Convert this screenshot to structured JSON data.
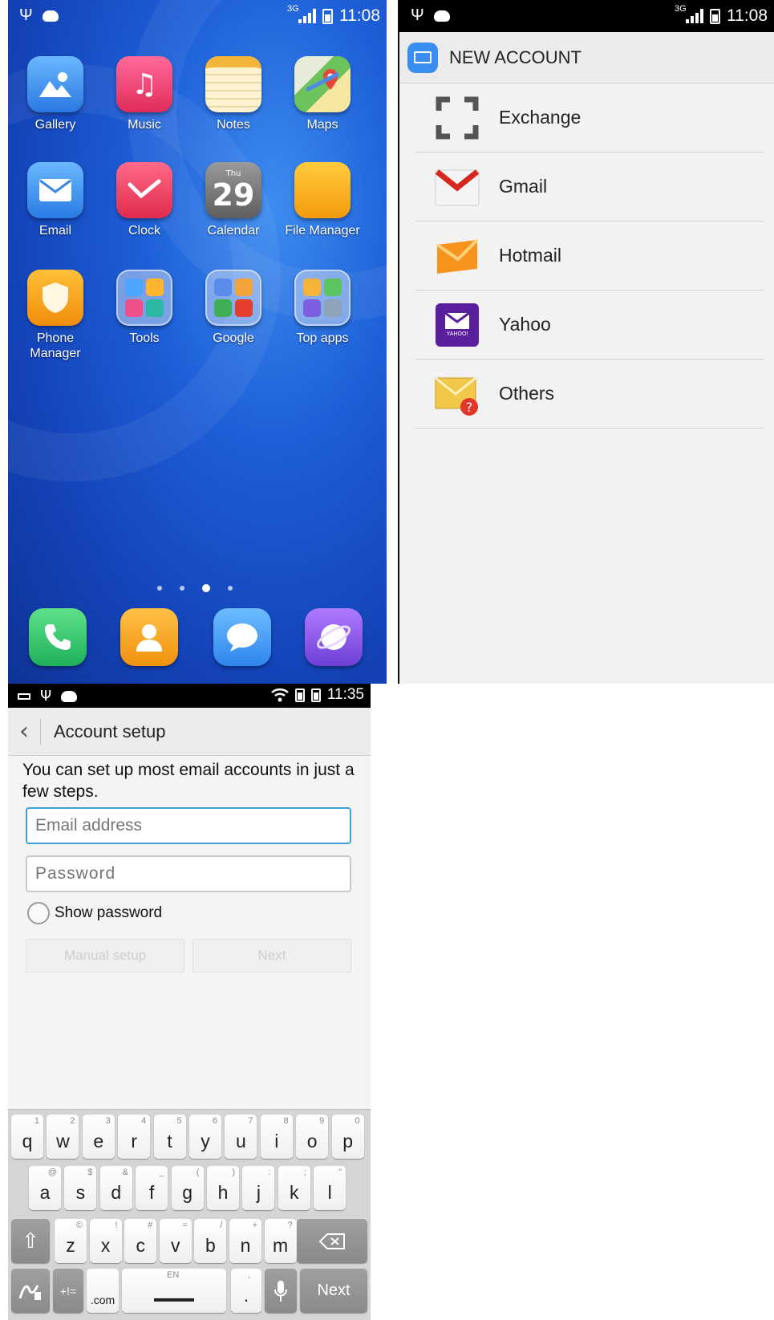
{
  "home": {
    "status": {
      "time": "11:08",
      "network": "3G"
    },
    "apps": [
      {
        "label": "Gallery",
        "icon": "gallery-icon"
      },
      {
        "label": "Music",
        "icon": "music-icon"
      },
      {
        "label": "Notes",
        "icon": "notes-icon"
      },
      {
        "label": "Maps",
        "icon": "maps-icon"
      },
      {
        "label": "Email",
        "icon": "email-icon"
      },
      {
        "label": "Clock",
        "icon": "clock-icon"
      },
      {
        "label": "Calendar",
        "icon": "calendar-icon",
        "day_name": "Thu",
        "day_number": "29"
      },
      {
        "label": "File Manager",
        "icon": "file-manager-icon"
      },
      {
        "label": "Phone Manager",
        "icon": "phone-manager-icon"
      },
      {
        "label": "Tools",
        "icon": "tools-folder-icon"
      },
      {
        "label": "Google",
        "icon": "google-folder-icon"
      },
      {
        "label": "Top apps",
        "icon": "top-apps-folder-icon"
      }
    ],
    "dock": [
      "phone-icon",
      "contacts-icon",
      "messages-icon",
      "browser-icon"
    ],
    "page_indicator": {
      "pages": 4,
      "current": 3
    }
  },
  "new_account": {
    "status": {
      "time": "11:08",
      "network": "3G"
    },
    "title": "NEW ACCOUNT",
    "options": [
      {
        "label": "Exchange",
        "icon": "exchange-icon"
      },
      {
        "label": "Gmail",
        "icon": "gmail-icon"
      },
      {
        "label": "Hotmail",
        "icon": "hotmail-icon"
      },
      {
        "label": "Yahoo",
        "icon": "yahoo-icon",
        "badge": "YAHOO!"
      },
      {
        "label": "Others",
        "icon": "others-mail-icon"
      }
    ]
  },
  "setup": {
    "status": {
      "time": "11:35"
    },
    "title": "Account setup",
    "intro": "You can set up most email accounts in just a few steps.",
    "email_placeholder": "Email address",
    "password_placeholder": "Password",
    "show_password": "Show password",
    "manual_setup": "Manual setup",
    "next": "Next",
    "keyboard": {
      "row1": [
        [
          "q",
          "1"
        ],
        [
          "w",
          "2"
        ],
        [
          "e",
          "3"
        ],
        [
          "r",
          "4"
        ],
        [
          "t",
          "5"
        ],
        [
          "y",
          "6"
        ],
        [
          "u",
          "7"
        ],
        [
          "i",
          "8"
        ],
        [
          "o",
          "9"
        ],
        [
          "p",
          "0"
        ]
      ],
      "row2": [
        [
          "a",
          "@"
        ],
        [
          "s",
          "$"
        ],
        [
          "d",
          "&"
        ],
        [
          "f",
          "_"
        ],
        [
          "g",
          "("
        ],
        [
          "h",
          ")"
        ],
        [
          "j",
          ":"
        ],
        [
          "k",
          ";"
        ],
        [
          "l",
          "\""
        ]
      ],
      "row3": [
        [
          "z",
          "©"
        ],
        [
          "x",
          "!"
        ],
        [
          "c",
          "#"
        ],
        [
          "v",
          "="
        ],
        [
          "b",
          "/"
        ],
        [
          "n",
          "+"
        ],
        [
          "m",
          "?"
        ]
      ],
      "symbols_key": "+!=",
      "com_key": ".com",
      "space_lang": "EN",
      "period_key": ".",
      "period_hint": ",",
      "action_key": "Next"
    },
    "colors": {
      "focus_border": "#3da0d6"
    }
  }
}
